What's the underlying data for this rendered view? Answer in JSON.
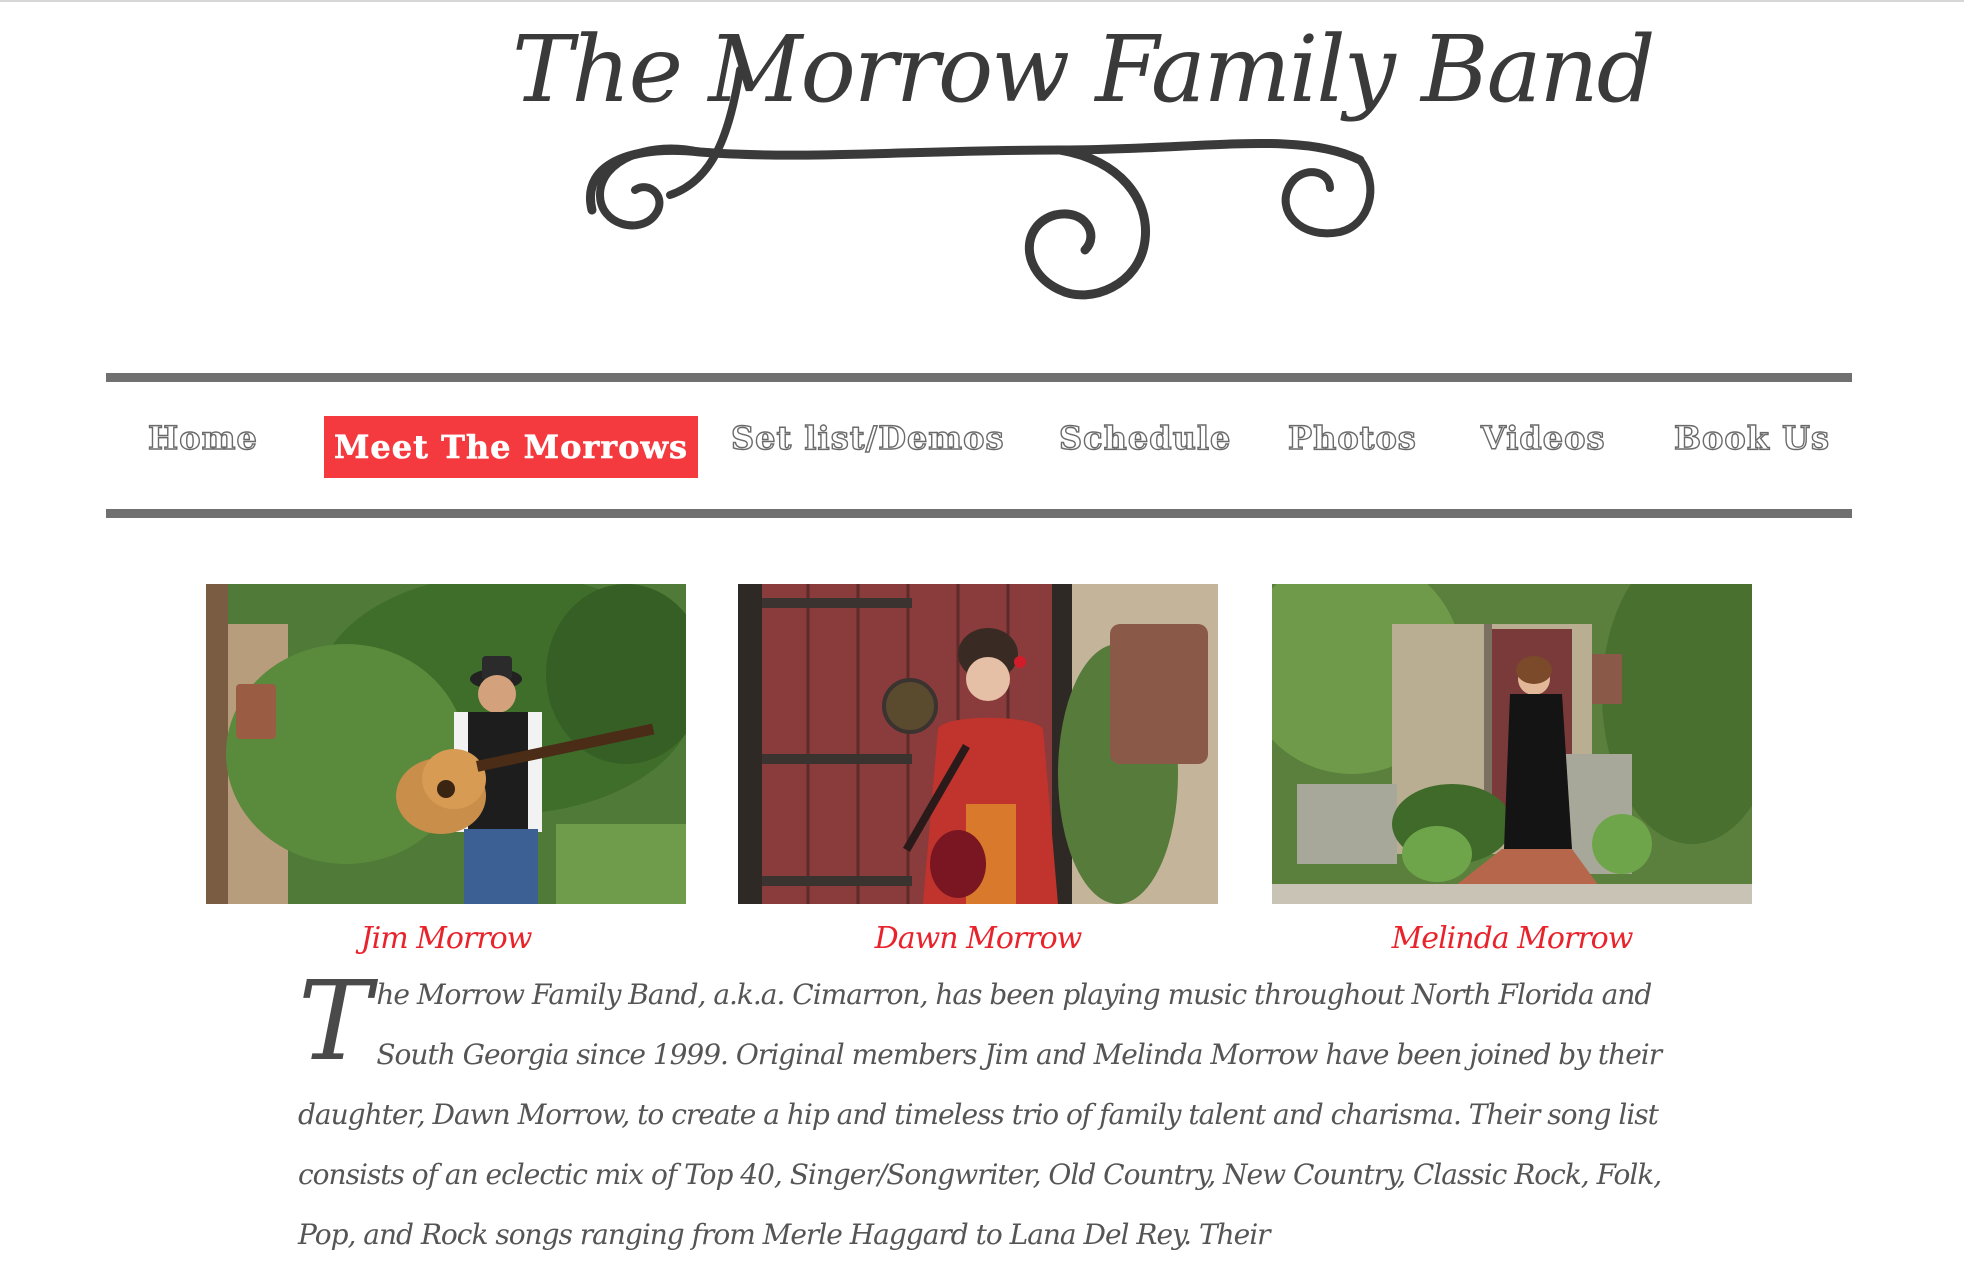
{
  "site": {
    "title": "The Morrow Family Band"
  },
  "nav": {
    "items": [
      {
        "label": "Home",
        "name": "nav-home",
        "active": false
      },
      {
        "label": "Meet The Morrows",
        "name": "nav-meet-the-morrows",
        "active": true
      },
      {
        "label": "Set list/Demos",
        "name": "nav-set-list-demos",
        "active": false
      },
      {
        "label": "Schedule",
        "name": "nav-schedule",
        "active": false
      },
      {
        "label": "Photos",
        "name": "nav-photos",
        "active": false
      },
      {
        "label": "Videos",
        "name": "nav-videos",
        "active": false
      },
      {
        "label": "Book Us",
        "name": "nav-book-us",
        "active": false
      }
    ],
    "active_color": "#f43a3f",
    "rule_color": "#707070"
  },
  "members": [
    {
      "name": "Jim Morrow"
    },
    {
      "name": "Dawn Morrow"
    },
    {
      "name": "Melinda Morrow"
    }
  ],
  "caption_color": "#e8232b",
  "intro": {
    "dropcap": "T",
    "text": "he Morrow Family Band, a.k.a. Cimarron, has been playing music throughout North Florida and South Georgia since 1999. Original members Jim and Melinda Morrow have been joined by their daughter, Dawn Morrow, to create a hip and timeless trio of family talent and charisma. Their song list consists of an eclectic mix of Top 40, Singer/Songwriter, Old Country, New Country, Classic Rock, Folk, Pop, and Rock songs ranging from Merle Haggard to Lana Del Rey. Their"
  }
}
